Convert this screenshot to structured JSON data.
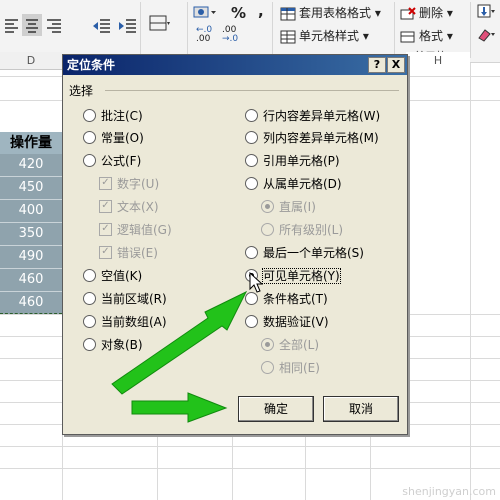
{
  "ribbon": {
    "percent": "%",
    "comma": ",",
    "dec_increase": "←.0\n.00",
    "dec_decrease": ".00\n→.0",
    "table_format": "套用表格格式",
    "cell_style": "单元格样式",
    "delete": "删除",
    "format": "格式",
    "cells_group": "单元格"
  },
  "sheet": {
    "col_d": "D",
    "col_h": "H",
    "header": "操作量",
    "values": [
      "420",
      "450",
      "400",
      "350",
      "490",
      "460",
      "460"
    ]
  },
  "dialog": {
    "title": "定位条件",
    "help": "?",
    "close": "X",
    "group": "选择",
    "left_options": {
      "comments": "批注(C)",
      "constants": "常量(O)",
      "formulas": "公式(F)",
      "numbers": "数字(U)",
      "text": "文本(X)",
      "logicals": "逻辑值(G)",
      "errors": "错误(E)",
      "blanks": "空值(K)",
      "current_region": "当前区域(R)",
      "current_array": "当前数组(A)",
      "objects": "对象(B)"
    },
    "right_options": {
      "row_diff": "行内容差异单元格(W)",
      "col_diff": "列内容差异单元格(M)",
      "precedents": "引用单元格(P)",
      "dependents": "从属单元格(D)",
      "direct": "直属(I)",
      "all_levels": "所有级别(L)",
      "last_cell": "最后一个单元格(S)",
      "visible_cells": "可见单元格(Y)",
      "cond_format": "条件格式(T)",
      "data_validation": "数据验证(V)",
      "all": "全部(L)",
      "same": "相同(E)"
    },
    "ok": "确定",
    "cancel": "取消"
  },
  "colors": {
    "arrow": "#22c21a",
    "titlebar": "#0a246a"
  },
  "watermark": "shenjingyan.com"
}
